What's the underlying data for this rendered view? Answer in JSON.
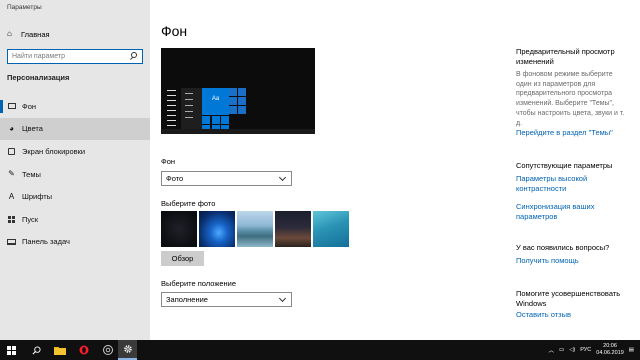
{
  "window": {
    "title": "Параметры"
  },
  "sidebar": {
    "home_label": "Главная",
    "search_placeholder": "Найти параметр",
    "section_title": "Персонализация",
    "items": [
      {
        "label": "Фон",
        "icon": "image-icon"
      },
      {
        "label": "Цвета",
        "icon": "palette-icon"
      },
      {
        "label": "Экран блокировки",
        "icon": "lock-screen-icon"
      },
      {
        "label": "Темы",
        "icon": "brush-icon"
      },
      {
        "label": "Шрифты",
        "icon": "font-icon"
      },
      {
        "label": "Пуск",
        "icon": "start-icon"
      },
      {
        "label": "Панель задач",
        "icon": "taskbar-icon"
      }
    ]
  },
  "main": {
    "title": "Фон",
    "preview_tile_label": "Aa",
    "background_label": "Фон",
    "background_value": "Фото",
    "choose_photo_label": "Выберите фото",
    "browse_button": "Обзор",
    "fit_label": "Выберите положение",
    "fit_value": "Заполнение"
  },
  "right": {
    "preview_heading": "Предварительный просмотр изменений",
    "preview_text": "В фоновом режиме выберите один из параметров для предварительного просмотра изменений. Выберите \"Темы\", чтобы настроить цвета, звуки и т. д.",
    "themes_link": "Перейдите в раздел \"Темы\"",
    "related_heading": "Сопутствующие параметры",
    "high_contrast_link": "Параметры высокой контрастности",
    "sync_link": "Синхронизация ваших параметров",
    "question_heading": "У вас появились вопросы?",
    "help_link": "Получить помощь",
    "improve_heading": "Помогите усовершенствовать Windows",
    "feedback_link": "Оставить отзыв"
  },
  "taskbar": {
    "language": "РУС",
    "time": "20:06",
    "date": "04.06.2019"
  },
  "colors": {
    "accent": "#0063b1",
    "sidebar_bg": "#e6e6e6",
    "taskbar_bg": "#101010"
  }
}
